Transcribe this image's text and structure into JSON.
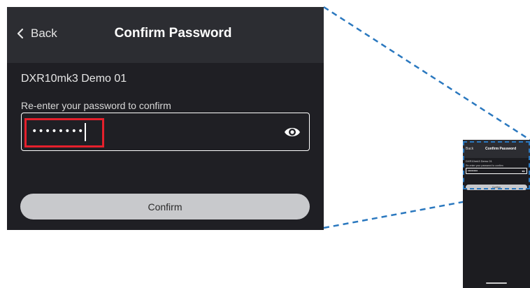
{
  "header": {
    "back_label": "Back",
    "title": "Confirm Password"
  },
  "device": {
    "name": "DXR10mk3 Demo 01"
  },
  "password_field": {
    "label": "Re-enter your password to confirm",
    "value": "••••••••",
    "visibility_icon": "eye-icon"
  },
  "confirm": {
    "label": "Confirm"
  },
  "thumbnail": {
    "back_label": "Back",
    "title": "Confirm Password",
    "device_name": "DXR10mk3 Demo 01",
    "field_label": "Re-enter your password to confirm",
    "value": "••••••••",
    "confirm_label": "Confirm"
  },
  "colors": {
    "screen_bg": "#1f1f24",
    "header_bg": "#2c2d32",
    "button_bg": "#c8c9cc",
    "highlight": "#e5202c",
    "callout": "#2a78bf"
  }
}
